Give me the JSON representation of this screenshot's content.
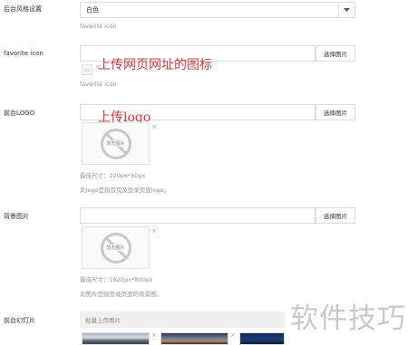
{
  "style": {
    "label": "后台风格设置",
    "selected": "白色"
  },
  "favicon": {
    "label": "favorite icon",
    "button": "选择图片",
    "hint_top": "favorite icon",
    "hint_bottom": "favorite icon",
    "annotation": "上传网页网址的图标",
    "tiny": "ico"
  },
  "logo": {
    "label": "前台LOGO",
    "button": "选择图片",
    "annotation": "上传logo",
    "placeholder_text": "暂无图片",
    "size": "最佳尺寸：220px*50px",
    "desc": "此logo是指首页及登录页面logo。"
  },
  "background": {
    "label": "背景图片",
    "button": "选择图片",
    "placeholder_text": "暂无图片",
    "size": "最佳尺寸：1920px*800px",
    "desc": "此图片是指登录页面的背景图。"
  },
  "slider": {
    "label": "前台幻灯片",
    "batch": "批量上传图片"
  },
  "watermark": "软件技巧",
  "colors": {
    "annotation": "#e0353a",
    "watermark": "#c9c9c9"
  }
}
